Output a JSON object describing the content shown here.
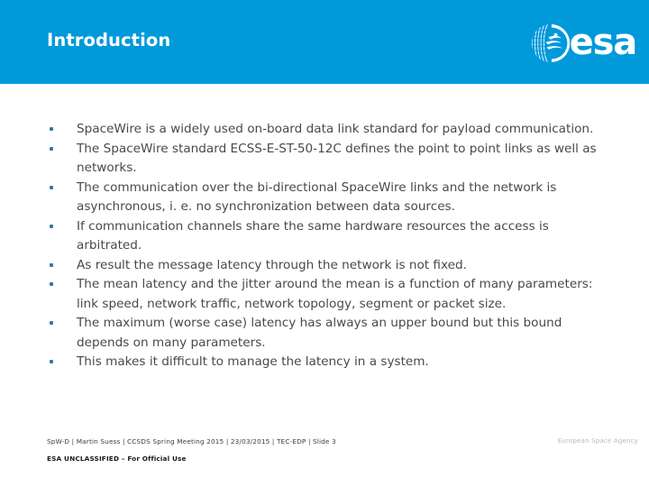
{
  "header": {
    "title": "Introduction",
    "background_color": "#0099da",
    "title_color": "#ffffff",
    "logo": {
      "name": "esa-logo",
      "wordmark": "esa"
    }
  },
  "body": {
    "text_color": "#494949",
    "bullet_color": "#2e7f96",
    "bullets": [
      "SpaceWire is a widely used on-board data link standard for payload communication.",
      "The SpaceWire standard ECSS-E-ST-50-12C defines the point to point links as well as networks.",
      "The communication over the bi-directional SpaceWire links and the network is asynchronous, i. e. no synchronization between data sources.",
      "If communication channels share the same hardware resources the access is arbitrated.",
      "As result the message latency through the network is not fixed.",
      "The mean latency and the jitter around the mean is a function of many parameters: link speed, network traffic, network topology, segment or packet size.",
      "The maximum (worse case) latency has always an upper bound but this bound depends on many parameters.",
      "This makes it difficult to manage the latency in a system."
    ]
  },
  "footer": {
    "reference_line": "SpW-D | Martin Suess | CCSDS Spring Meeting 2015 | 23/03/2015 | TEC-EDP | Slide  3",
    "classification": "ESA UNCLASSIFIED – For Official Use",
    "agency": "European Space Agency"
  }
}
